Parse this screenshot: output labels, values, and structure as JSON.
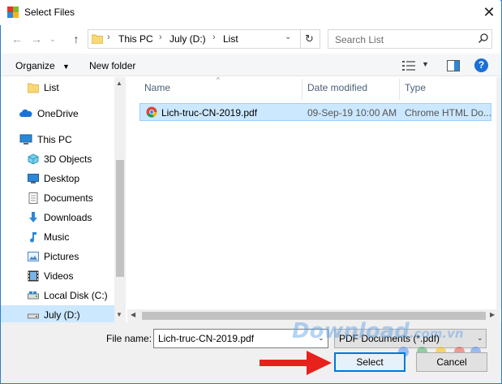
{
  "window": {
    "title": "Select Files",
    "border_color": "#2b7cd3"
  },
  "address": {
    "crumbs": [
      "This PC",
      "July (D:)",
      "List"
    ]
  },
  "search": {
    "placeholder": "Search List"
  },
  "toolbar": {
    "organize_label": "Organize",
    "new_folder_label": "New folder"
  },
  "nav": {
    "items": [
      {
        "label": "List",
        "icon": "folder-icon"
      },
      {
        "label": "OneDrive",
        "icon": "cloud-icon"
      },
      {
        "label": "This PC",
        "icon": "computer-icon"
      },
      {
        "label": "3D Objects",
        "icon": "cube-icon"
      },
      {
        "label": "Desktop",
        "icon": "desktop-icon"
      },
      {
        "label": "Documents",
        "icon": "documents-icon"
      },
      {
        "label": "Downloads",
        "icon": "download-arrow-icon"
      },
      {
        "label": "Music",
        "icon": "music-note-icon"
      },
      {
        "label": "Pictures",
        "icon": "pictures-icon"
      },
      {
        "label": "Videos",
        "icon": "film-icon"
      },
      {
        "label": "Local Disk (C:)",
        "icon": "drive-icon"
      },
      {
        "label": "July (D:)",
        "icon": "drive-icon",
        "selected": true
      }
    ]
  },
  "columns": {
    "name": "Name",
    "date": "Date modified",
    "type": "Type"
  },
  "files": [
    {
      "name": "Lich-truc-CN-2019.pdf",
      "date": "09-Sep-19 10:00 AM",
      "type": "Chrome HTML Do...",
      "icon": "chrome-icon",
      "selected": true
    }
  ],
  "footer": {
    "file_name_label": "File name:",
    "file_name_value": "Lich-truc-CN-2019.pdf",
    "file_type_value": "PDF Documents (*.pdf)",
    "select_label": "Select",
    "cancel_label": "Cancel"
  },
  "watermark": {
    "main": "Download",
    "suffix": ".com.vn"
  },
  "colors": {
    "selection": "#cce8ff",
    "accent": "#0078d7",
    "annotation_arrow": "#e8211c"
  }
}
